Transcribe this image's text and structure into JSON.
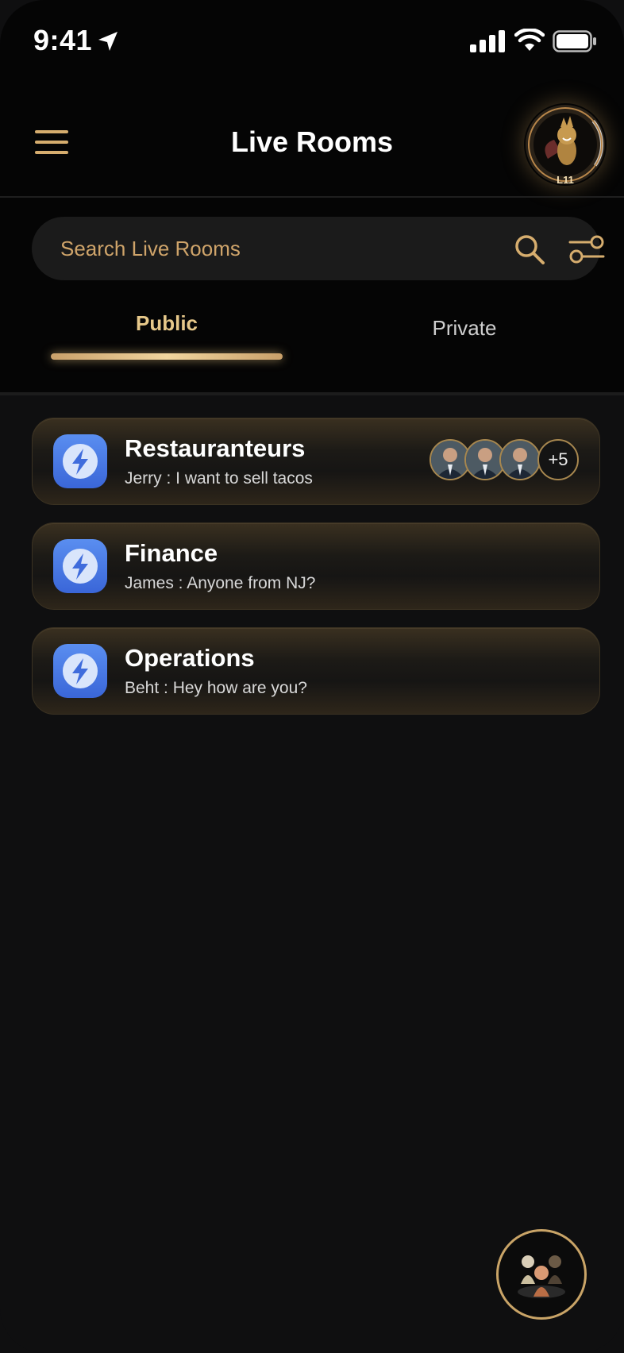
{
  "status_bar": {
    "time": "9:41"
  },
  "header": {
    "title": "Live Rooms",
    "level": "L11"
  },
  "search": {
    "placeholder": "Search Live Rooms"
  },
  "tabs": [
    {
      "label": "Public",
      "active": true
    },
    {
      "label": "Private",
      "active": false
    }
  ],
  "rooms": [
    {
      "name": "Restauranteurs",
      "last_message": "Jerry : I want to sell tacos",
      "extra_participants": "+5"
    },
    {
      "name": "Finance",
      "last_message": "James : Anyone from NJ?"
    },
    {
      "name": "Operations",
      "last_message": "Beht : Hey how are you?"
    }
  ],
  "colors": {
    "accent_gold": "#d6ad6e",
    "room_icon_blue": "#4a7ae6",
    "background": "#0f0f10"
  },
  "icons": [
    "location-arrow-icon",
    "signal-icon",
    "wifi-icon",
    "battery-icon",
    "hamburger-menu-icon",
    "search-icon",
    "filter-icon",
    "lightning-icon",
    "group-people-icon"
  ]
}
